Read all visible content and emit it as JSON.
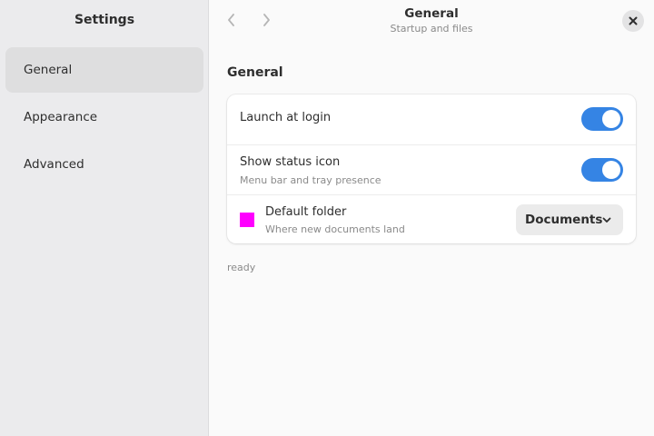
{
  "sidebar": {
    "title": "Settings",
    "items": [
      {
        "label": "General",
        "active": true
      },
      {
        "label": "Appearance",
        "active": false
      },
      {
        "label": "Advanced",
        "active": false
      }
    ]
  },
  "header": {
    "title": "General",
    "subtitle": "Startup and files",
    "back_icon": "chevron-left-icon",
    "forward_icon": "chevron-right-icon",
    "close_icon": "close-icon"
  },
  "section": {
    "title": "General"
  },
  "settings": {
    "launch_at_login": {
      "title": "Launch at login",
      "enabled": true
    },
    "show_status_icon": {
      "title": "Show status icon",
      "subtitle": "Menu bar and tray presence",
      "enabled": true
    },
    "default_folder": {
      "title": "Default folder",
      "subtitle": "Where new documents land",
      "value": "Documents",
      "swatch_color": "#ff00ff"
    }
  },
  "status": {
    "text": "ready"
  },
  "colors": {
    "accent": "#3584e4",
    "sidebar_bg": "#ebebed",
    "content_bg": "#fafafa"
  }
}
